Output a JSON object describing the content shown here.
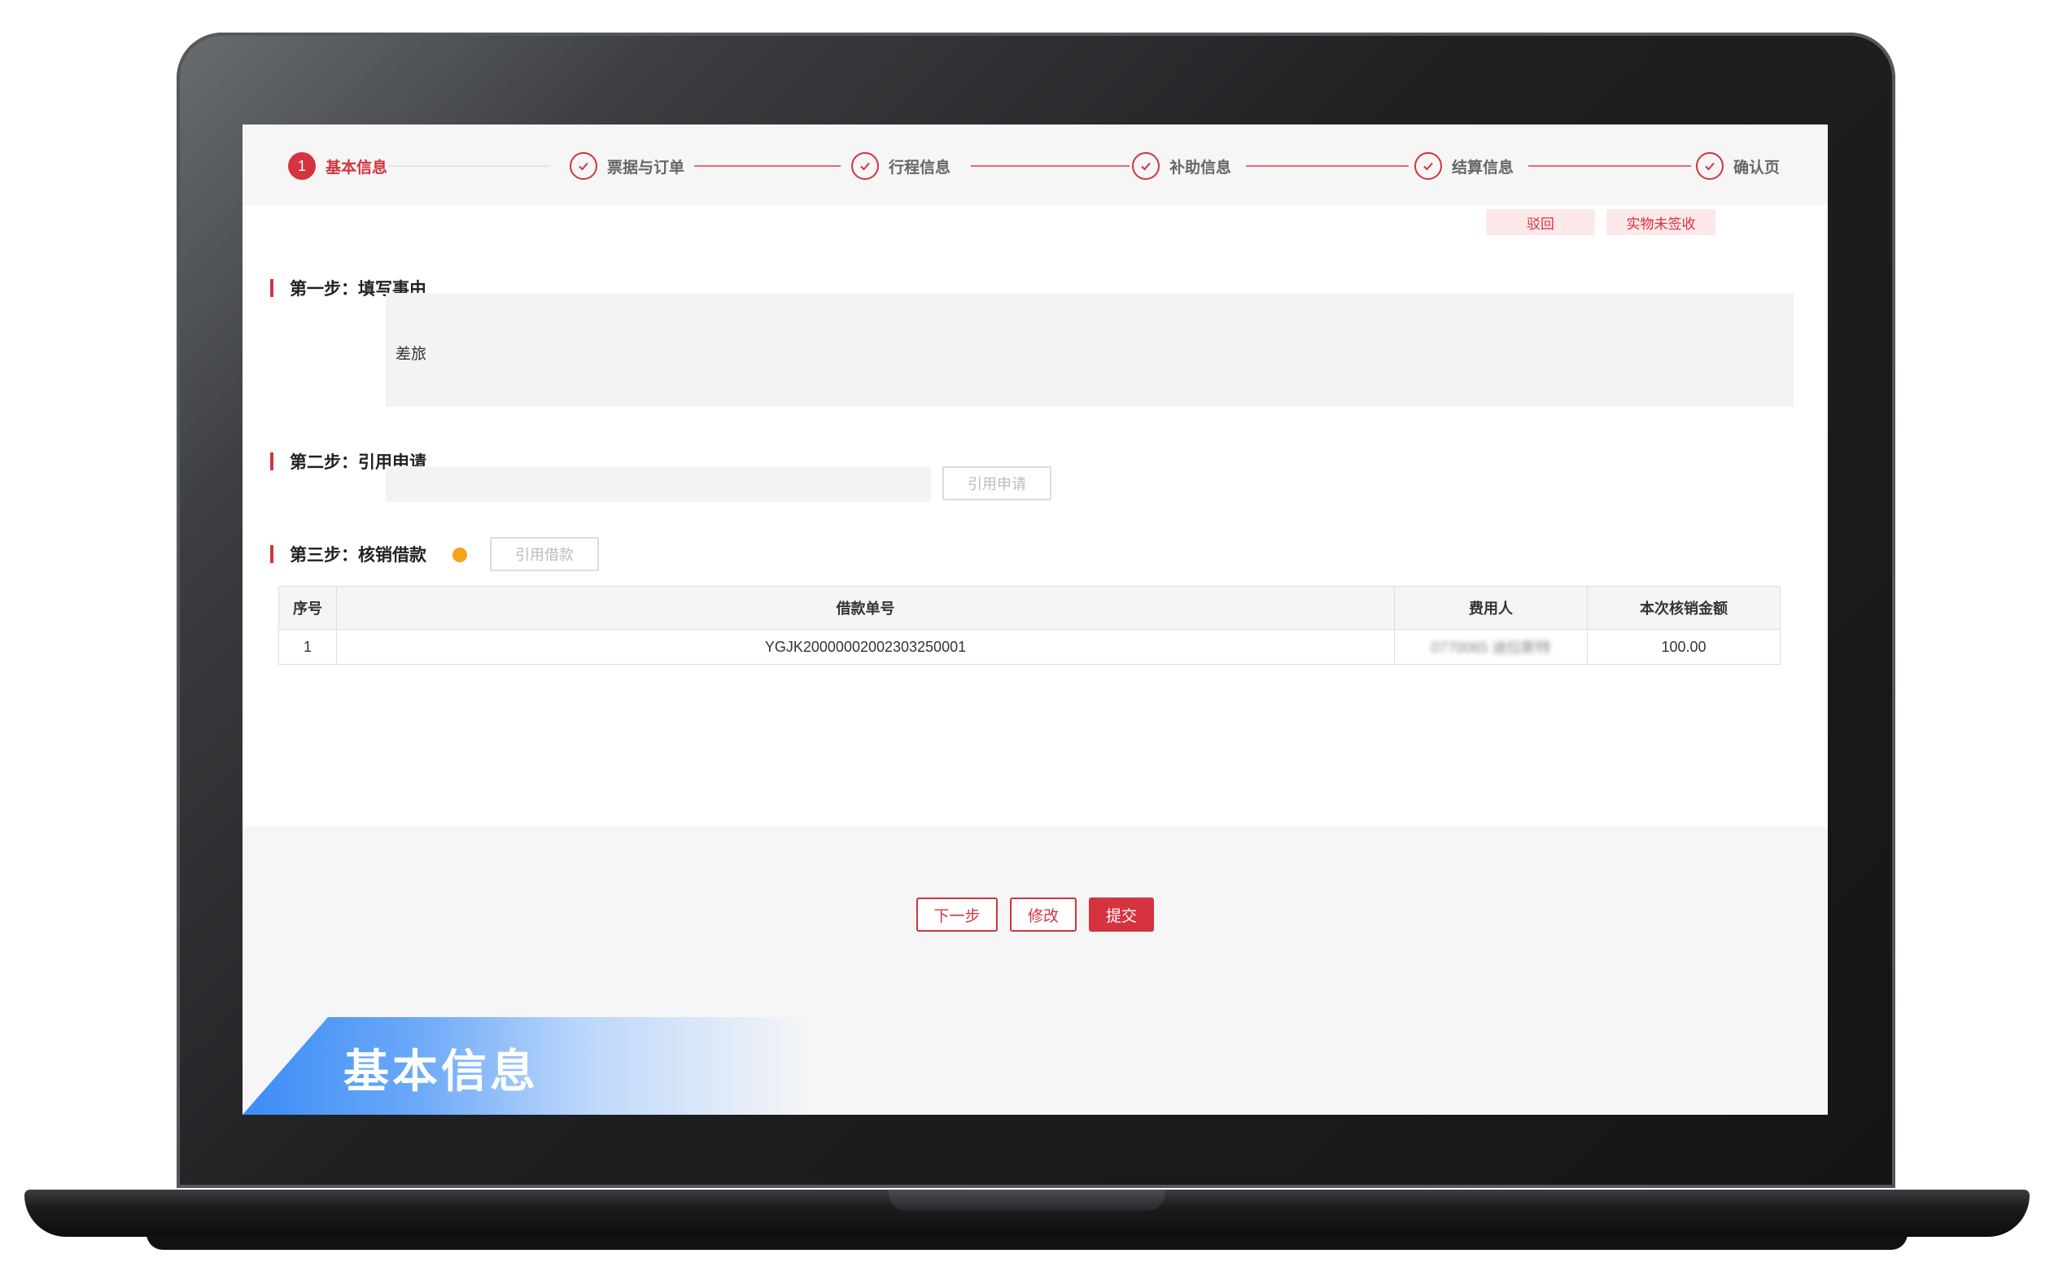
{
  "stepper": {
    "steps": [
      {
        "index": "1",
        "label": "基本信息"
      },
      {
        "index": "",
        "label": "票据与订单"
      },
      {
        "index": "",
        "label": "行程信息"
      },
      {
        "index": "",
        "label": "补助信息"
      },
      {
        "index": "",
        "label": "结算信息"
      },
      {
        "index": "",
        "label": "确认页"
      }
    ]
  },
  "top_actions": {
    "reject_label": "驳回",
    "unsigned_label": "实物未签收"
  },
  "section1": {
    "title": "第一步：填写事由",
    "reason_value": "差旅"
  },
  "section2": {
    "title": "第二步：引用申请",
    "input_value": "",
    "button_label": "引用申请"
  },
  "section3": {
    "title": "第三步：核销借款",
    "button_label": "引用借款",
    "table": {
      "headers": [
        "序号",
        "借款单号",
        "费用人",
        "本次核销金额"
      ],
      "rows": [
        {
          "index": "1",
          "loan_no": "YGJK20000002002303250001",
          "payer": "0770065 迪拉斯特",
          "amount": "100.00"
        }
      ]
    }
  },
  "bottom_actions": {
    "next_label": "下一步",
    "edit_label": "修改",
    "submit_label": "提交"
  },
  "banner": {
    "text": "基本信息"
  },
  "colors": {
    "accent": "#d4333f",
    "warning": "#f5a31a",
    "banner_blue": "#3b8cf5"
  }
}
